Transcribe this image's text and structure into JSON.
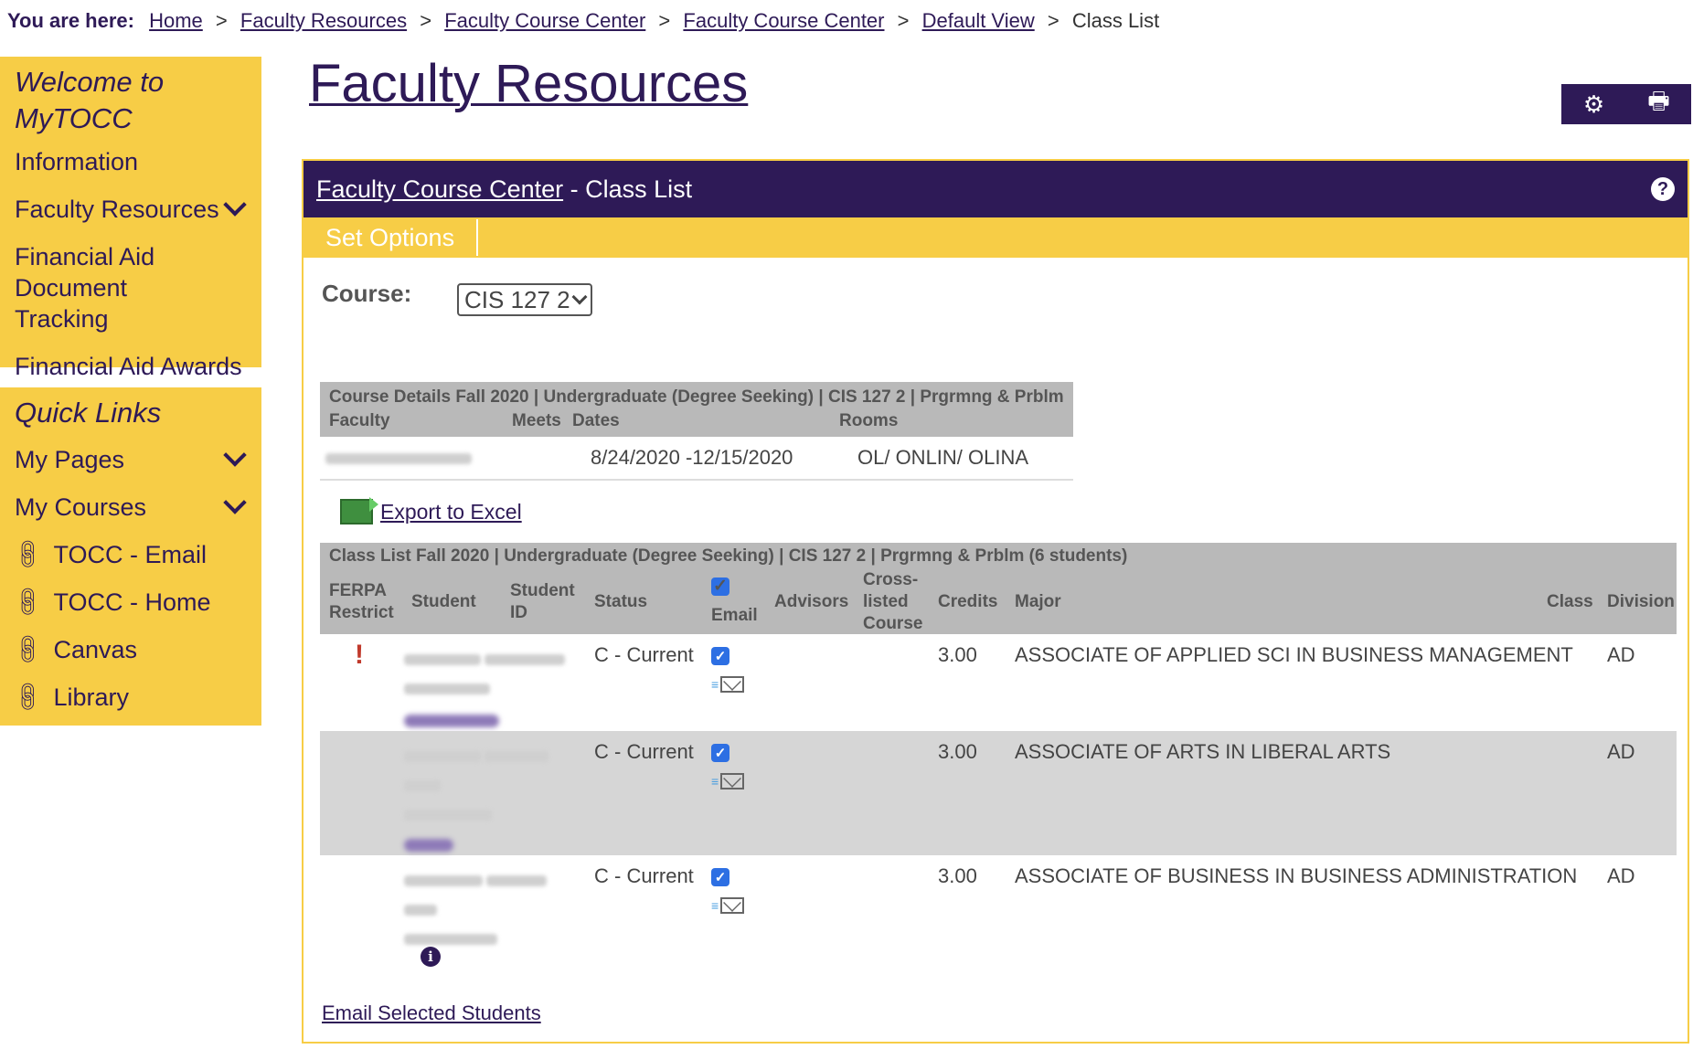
{
  "breadcrumb": {
    "label": "You are here:",
    "items": [
      "Home",
      "Faculty Resources",
      "Faculty Course Center",
      "Faculty Course Center",
      "Default View"
    ],
    "current": "Class List",
    "separator": ">"
  },
  "sidebar": {
    "welcome_title": "Welcome to MyTOCC",
    "items": [
      {
        "label": "Information"
      },
      {
        "label": "Faculty Resources",
        "has_chevron": true
      },
      {
        "label": "Financial Aid Document Tracking"
      },
      {
        "label": "Financial Aid Awards"
      }
    ],
    "quicklinks_title": "Quick Links",
    "quicklinks": [
      {
        "label": "My Pages",
        "has_chevron": true
      },
      {
        "label": "My Courses",
        "has_chevron": true
      },
      {
        "label": "TOCC - Email",
        "icon": "link-icon"
      },
      {
        "label": "TOCC - Home",
        "icon": "link-icon"
      },
      {
        "label": "Canvas",
        "icon": "link-icon"
      },
      {
        "label": "Library",
        "icon": "link-icon"
      }
    ]
  },
  "page": {
    "title": "Faculty Resources"
  },
  "toolbar": {
    "icons": [
      "gear-icon",
      "print-icon"
    ]
  },
  "panel": {
    "header_link": "Faculty Course Center",
    "header_rest": " - Class List",
    "set_options": "Set Options",
    "course_label": "Course:",
    "course_value": "CIS 127 2"
  },
  "course_details": {
    "title": "Course Details Fall 2020 | Undergraduate (Degree Seeking) | CIS 127 2 | Prgrmng & Prblm",
    "columns": [
      "Faculty",
      "Meets",
      "Dates",
      "Rooms"
    ],
    "dates": "8/24/2020 -12/15/2020",
    "rooms": "OL/ ONLIN/ OLINA"
  },
  "export_label": "Export to Excel",
  "class_list": {
    "title": "Class List Fall 2020 | Undergraduate (Degree Seeking) | CIS 127 2 | Prgrmng & Prblm (6 students)",
    "columns": {
      "ferpa": "FERPA Restrict",
      "student": "Student",
      "student_id": "Student ID",
      "status": "Status",
      "email": "Email",
      "advisors": "Advisors",
      "cross": "Cross-listed Course",
      "credits": "Credits",
      "major": "Major",
      "class": "Class",
      "division": "Division"
    },
    "rows": [
      {
        "ferpa": "!",
        "status": "C - Current",
        "credits": "3.00",
        "major": "ASSOCIATE OF APPLIED SCI IN BUSINESS MANAGEMENT",
        "division": "AD"
      },
      {
        "ferpa": "",
        "status": "C - Current",
        "credits": "3.00",
        "major": "ASSOCIATE OF ARTS IN LIBERAL ARTS",
        "division": "AD"
      },
      {
        "ferpa": "",
        "status": "C - Current",
        "credits": "3.00",
        "major": "ASSOCIATE OF BUSINESS IN BUSINESS ADMINISTRATION",
        "division": "AD"
      }
    ]
  },
  "email_selected": "Email Selected Students",
  "colors": {
    "brand_purple": "#2e1a57",
    "brand_yellow": "#f7cd46",
    "checkbox_blue": "#2d6fe3"
  }
}
